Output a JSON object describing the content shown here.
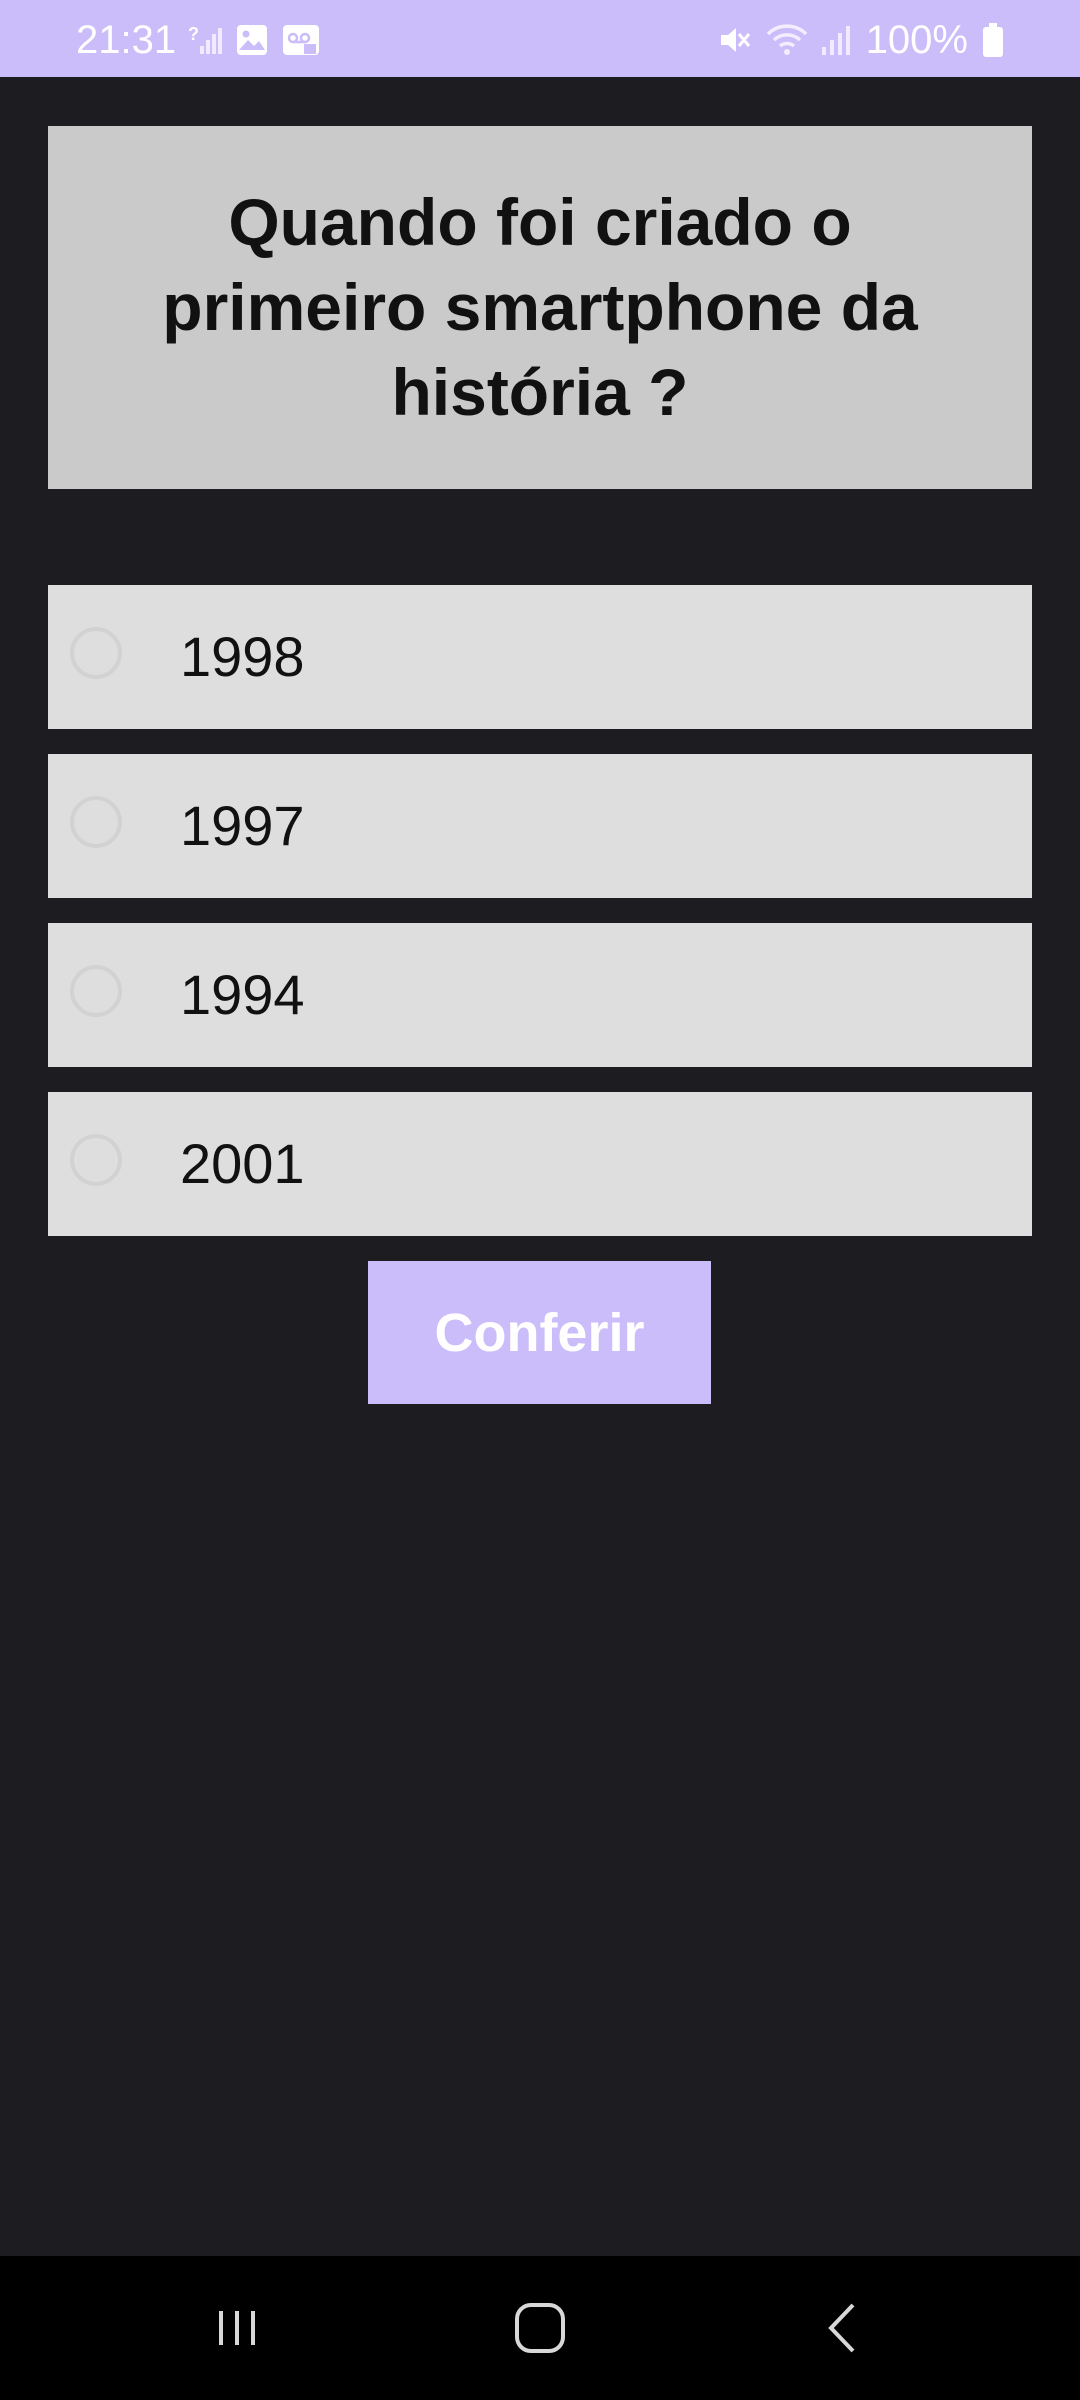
{
  "status_bar": {
    "time": "21:31",
    "battery": "100%",
    "icons": [
      "signal-unknown-icon",
      "image-icon",
      "voicemail-icon",
      "mute-icon",
      "wifi-icon",
      "signal-icon",
      "battery-icon"
    ]
  },
  "quiz": {
    "question": "Quando foi criado o primeiro smartphone da história ?",
    "options": [
      {
        "label": "1998",
        "selected": false
      },
      {
        "label": "1997",
        "selected": false
      },
      {
        "label": "1994",
        "selected": false
      },
      {
        "label": "2001",
        "selected": false
      }
    ],
    "check_button": "Conferir"
  },
  "nav_bar": {
    "icons": [
      "recent-apps-icon",
      "home-icon",
      "back-icon"
    ]
  },
  "colors": {
    "accent": "#cbbcfa",
    "background": "#1d1c21",
    "question_card": "#cacaca",
    "option_bg": "#dedede",
    "nav_bar": "#000000"
  }
}
